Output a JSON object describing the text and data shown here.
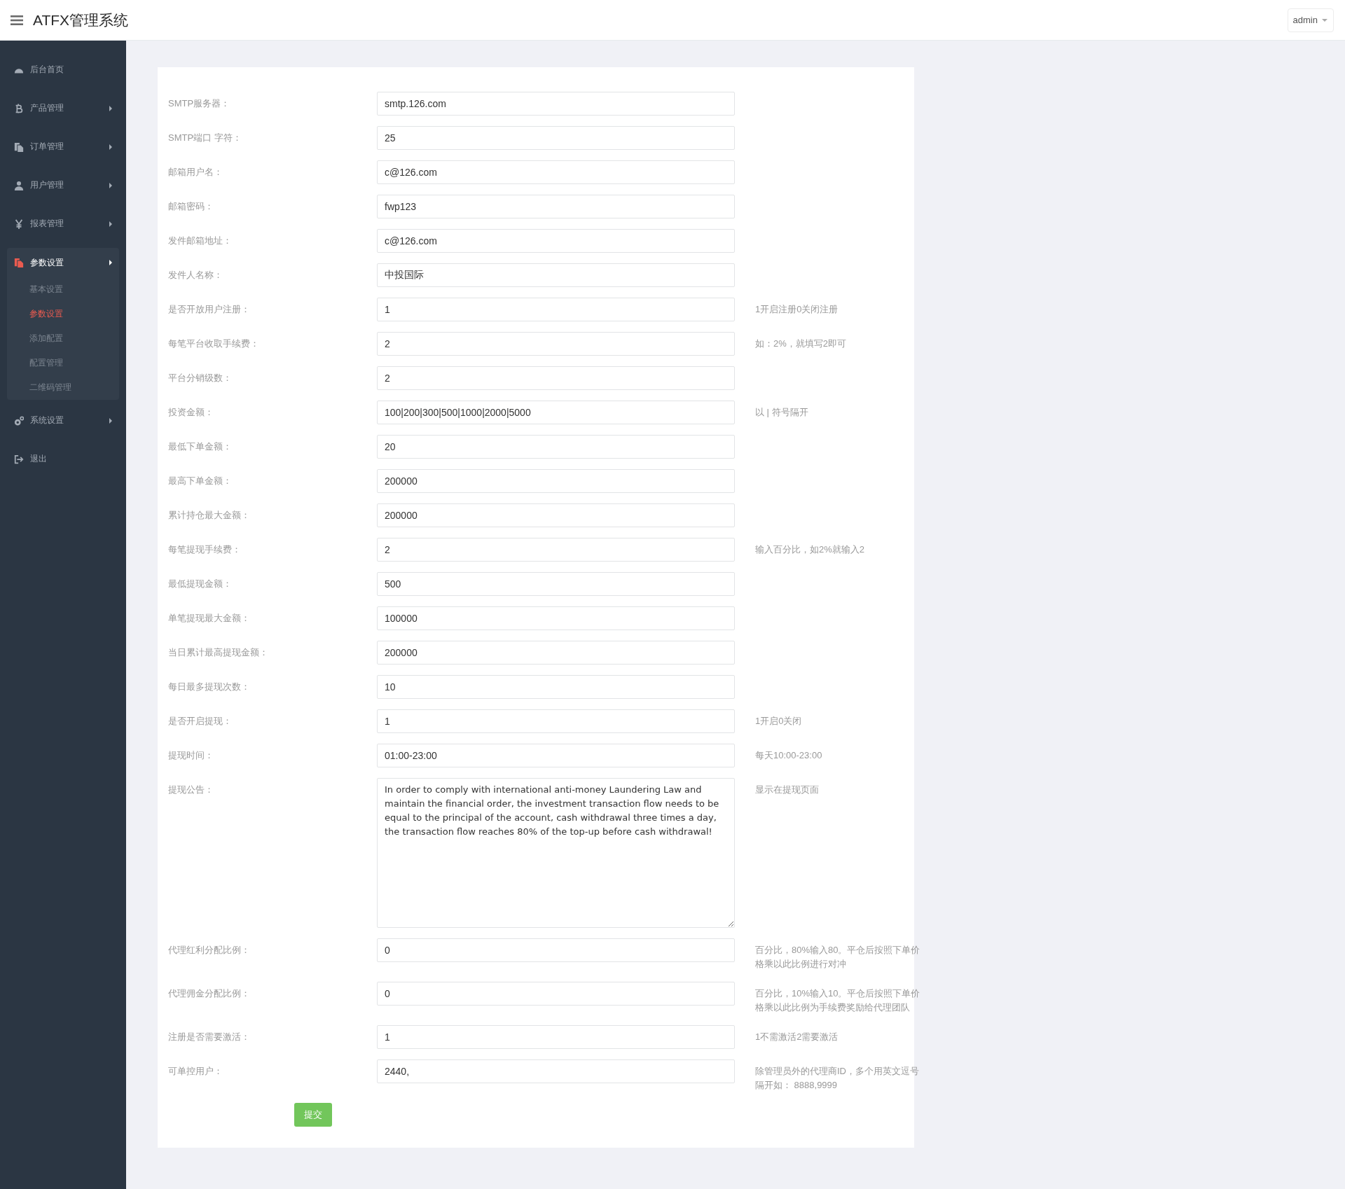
{
  "header": {
    "title": "ATFX管理系统",
    "user_menu": "admin"
  },
  "sidebar": {
    "items": [
      {
        "label": "后台首页",
        "kind": "link",
        "selected": false,
        "expanded": false
      },
      {
        "label": "产品管理",
        "kind": "menu",
        "selected": false,
        "expanded": false
      },
      {
        "label": "订单管理",
        "kind": "menu",
        "selected": false,
        "expanded": false
      },
      {
        "label": "用户管理",
        "kind": "menu",
        "selected": false,
        "expanded": false
      },
      {
        "label": "报表管理",
        "kind": "menu",
        "selected": false,
        "expanded": false
      },
      {
        "label": "参数设置",
        "kind": "menu",
        "selected": true,
        "expanded": true,
        "children": [
          {
            "label": "基本设置",
            "selected": false
          },
          {
            "label": "参数设置",
            "selected": true
          },
          {
            "label": "添加配置",
            "selected": false
          },
          {
            "label": "配置管理",
            "selected": false
          },
          {
            "label": "二维码管理",
            "selected": false
          }
        ]
      },
      {
        "label": "系统设置",
        "kind": "menu",
        "selected": false,
        "expanded": false
      },
      {
        "label": "退出",
        "kind": "link",
        "selected": false,
        "expanded": false
      }
    ]
  },
  "form": {
    "fields": [
      {
        "label": "SMTP服务器：",
        "kind": "input",
        "value": "smtp.126.com"
      },
      {
        "label": "SMTP端口 字符：",
        "kind": "input",
        "value": "25"
      },
      {
        "label": "邮箱用户名：",
        "kind": "input",
        "value": "c@126.com"
      },
      {
        "label": "邮箱密码：",
        "kind": "input",
        "value": "fwp123"
      },
      {
        "label": "发件邮箱地址：",
        "kind": "input",
        "value": "c@126.com"
      },
      {
        "label": "发件人名称：",
        "kind": "input",
        "value": "中投国际"
      },
      {
        "label": "是否开放用户注册：",
        "kind": "input",
        "value": "1",
        "hint": "1开启注册0关闭注册"
      },
      {
        "label": "每笔平台收取手续费：",
        "kind": "input",
        "value": "2",
        "hint": "如：2%，就填写2即可"
      },
      {
        "label": "平台分销级数：",
        "kind": "input",
        "value": "2"
      },
      {
        "label": "投资金额：",
        "kind": "input",
        "value": "100|200|300|500|1000|2000|5000",
        "hint": "以 | 符号隔开"
      },
      {
        "label": "最低下单金额：",
        "kind": "input",
        "value": "20"
      },
      {
        "label": "最高下单金额：",
        "kind": "input",
        "value": "200000"
      },
      {
        "label": "累计持仓最大金额：",
        "kind": "input",
        "value": "200000"
      },
      {
        "label": "每笔提现手续费：",
        "kind": "input",
        "value": "2",
        "hint": "输入百分比，如2%就输入2"
      },
      {
        "label": "最低提现金额：",
        "kind": "input",
        "value": "500"
      },
      {
        "label": "单笔提现最大金额：",
        "kind": "input",
        "value": "100000"
      },
      {
        "label": "当日累计最高提现金额：",
        "kind": "input",
        "value": "200000"
      },
      {
        "label": "每日最多提现次数：",
        "kind": "input",
        "value": "10"
      },
      {
        "label": "是否开启提现：",
        "kind": "input",
        "value": "1",
        "hint": "1开启0关闭"
      },
      {
        "label": "提现时间：",
        "kind": "input",
        "value": "01:00-23:00",
        "hint": "每天10:00-23:00"
      },
      {
        "label": "提现公告：",
        "kind": "textarea",
        "value": "In order to comply with international anti-money Laundering Law and maintain the financial order, the investment transaction flow needs to be equal to the principal of the account, cash withdrawal three times a day, the transaction flow reaches 80% of the top-up before cash withdrawal!",
        "hint": "显示在提现页面"
      },
      {
        "label": "代理红利分配比例：",
        "kind": "input",
        "value": "0",
        "hint": "百分比，80%输入80。平仓后按照下单价格乘以此比例进行对冲"
      },
      {
        "label": "代理佣金分配比例：",
        "kind": "input",
        "value": "0",
        "hint": "百分比，10%输入10。平仓后按照下单价格乘以此比例为手续费奖励给代理团队"
      },
      {
        "label": "注册是否需要激活：",
        "kind": "input",
        "value": "1",
        "hint": "1不需激活2需要激活"
      },
      {
        "label": "可单控用户：",
        "kind": "input",
        "value": "2440,",
        "hint": "除管理员外的代理商ID，多个用英文逗号隔开如： 8888,9999"
      }
    ],
    "submit": "提交"
  }
}
